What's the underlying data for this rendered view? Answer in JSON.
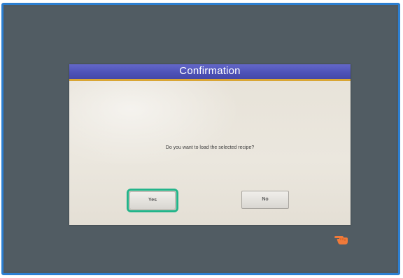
{
  "dialog": {
    "title": "Confirmation",
    "message": "Do you want to load the selected recipe?",
    "yes_label": "Yes",
    "no_label": "No",
    "focused_button": "Yes"
  },
  "colors": {
    "frame_border": "#2c7fd1",
    "screen_background": "#515c63",
    "title_bar": "#4e52b8",
    "title_underline": "#d9a534",
    "focus_outline": "#23b48a",
    "hand_icon": "#f07a3a"
  },
  "icons": {
    "pointer": "hand-pointer-icon"
  }
}
